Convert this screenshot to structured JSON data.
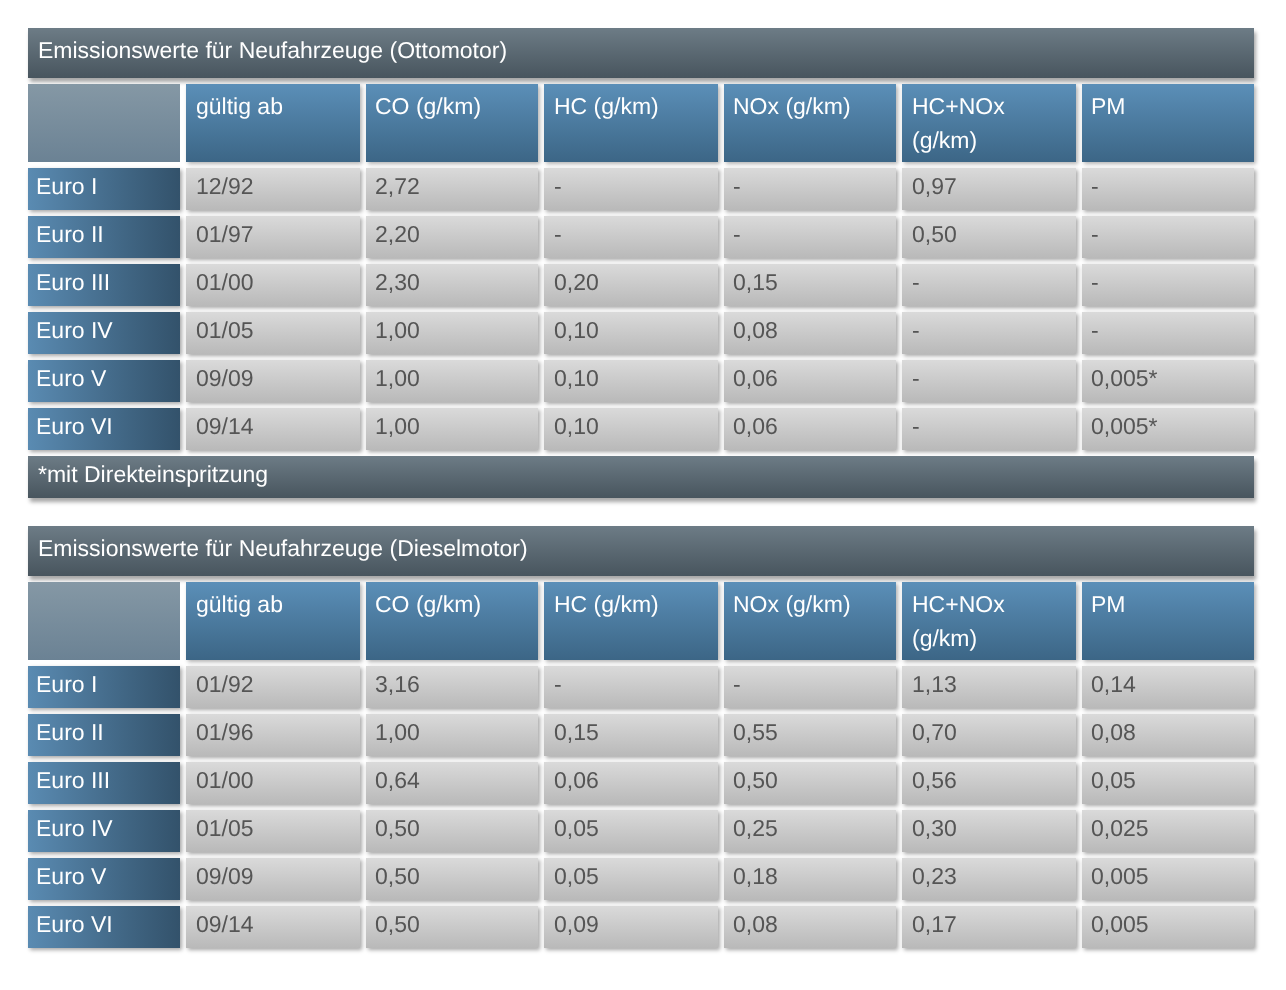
{
  "tables": [
    {
      "title": "Emissionswerte für Neufahrzeuge (Ottomotor)",
      "columns": [
        "gültig ab",
        "CO (g/km)",
        "HC (g/km)",
        "NOx (g/km)",
        "HC+NOx (g/km)",
        "PM"
      ],
      "rows": [
        {
          "label": "Euro I",
          "cells": [
            "12/92",
            "2,72",
            "-",
            "-",
            "0,97",
            "-"
          ]
        },
        {
          "label": "Euro II",
          "cells": [
            "01/97",
            "2,20",
            "-",
            "-",
            "0,50",
            "-"
          ]
        },
        {
          "label": "Euro III",
          "cells": [
            "01/00",
            "2,30",
            "0,20",
            "0,15",
            "-",
            "-"
          ]
        },
        {
          "label": "Euro IV",
          "cells": [
            "01/05",
            "1,00",
            "0,10",
            "0,08",
            "-",
            "-"
          ]
        },
        {
          "label": "Euro V",
          "cells": [
            "09/09",
            "1,00",
            "0,10",
            "0,06",
            "-",
            "0,005*"
          ]
        },
        {
          "label": "Euro VI",
          "cells": [
            "09/14",
            "1,00",
            "0,10",
            "0,06",
            "-",
            "0,005*"
          ]
        }
      ],
      "footnote": "*mit Direkteinspritzung"
    },
    {
      "title": "Emissionswerte für Neufahrzeuge (Dieselmotor)",
      "columns": [
        "gültig ab",
        "CO (g/km)",
        "HC (g/km)",
        "NOx (g/km)",
        "HC+NOx (g/km)",
        "PM"
      ],
      "rows": [
        {
          "label": "Euro I",
          "cells": [
            "01/92",
            "3,16",
            "-",
            "-",
            "1,13",
            "0,14"
          ]
        },
        {
          "label": "Euro II",
          "cells": [
            "01/96",
            "1,00",
            "0,15",
            "0,55",
            "0,70",
            "0,08"
          ]
        },
        {
          "label": "Euro III",
          "cells": [
            "01/00",
            "0,64",
            "0,06",
            "0,50",
            "0,56",
            "0,05"
          ]
        },
        {
          "label": "Euro IV",
          "cells": [
            "01/05",
            "0,50",
            "0,05",
            "0,25",
            "0,30",
            "0,025"
          ]
        },
        {
          "label": "Euro V",
          "cells": [
            "09/09",
            "0,50",
            "0,05",
            "0,18",
            "0,23",
            "0,005"
          ]
        },
        {
          "label": "Euro VI",
          "cells": [
            "09/14",
            "0,50",
            "0,09",
            "0,08",
            "0,17",
            "0,005"
          ]
        }
      ]
    }
  ]
}
